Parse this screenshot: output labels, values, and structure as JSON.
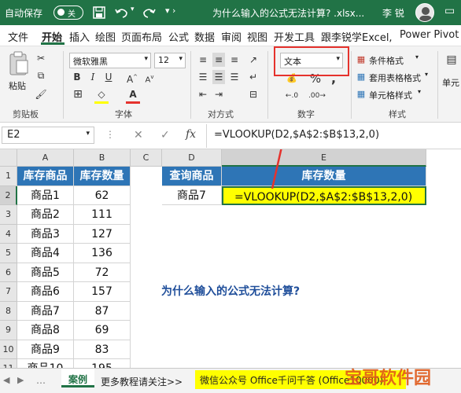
{
  "titlebar": {
    "autosave_label": "自动保存",
    "autosave_state": "关",
    "file_title": "为什么输入的公式无法计算? .xlsx...",
    "user_name": "李 锐"
  },
  "tabs": [
    "文件",
    "开始",
    "插入",
    "绘图",
    "页面布局",
    "公式",
    "数据",
    "审阅",
    "视图",
    "开发工具",
    "跟李锐学Excel,",
    "Power Pivot"
  ],
  "ribbon": {
    "paste_label": "粘贴",
    "clipboard_group": "剪贴板",
    "font_name": "微软雅黑",
    "font_size": "12",
    "font_group": "字体",
    "align_group": "对方式",
    "number_format": "文本",
    "number_group": "数字",
    "styles": [
      "条件格式",
      "套用表格格式",
      "单元格样式"
    ],
    "styles_group": "样式",
    "cells_label": "单元"
  },
  "formula_bar": {
    "name_box": "E2",
    "fx": "fx",
    "formula": "=VLOOKUP(D2,$A$2:$B$13,2,0)"
  },
  "grid": {
    "columns": [
      "A",
      "B",
      "C",
      "D",
      "E"
    ],
    "rows": [
      "1",
      "2",
      "3",
      "4",
      "5",
      "6",
      "7",
      "8",
      "9",
      "10",
      "11"
    ],
    "header_a": "库存商品",
    "header_b": "库存数量",
    "items": [
      {
        "name": "商品1",
        "qty": "62"
      },
      {
        "name": "商品2",
        "qty": "111"
      },
      {
        "name": "商品3",
        "qty": "127"
      },
      {
        "name": "商品4",
        "qty": "136"
      },
      {
        "name": "商品5",
        "qty": "72"
      },
      {
        "name": "商品6",
        "qty": "157"
      },
      {
        "name": "商品7",
        "qty": "87"
      },
      {
        "name": "商品8",
        "qty": "69"
      },
      {
        "name": "商品9",
        "qty": "83"
      },
      {
        "name": "商品10",
        "qty": "195"
      }
    ],
    "query_header_d": "查询商品",
    "query_header_e": "库存数量",
    "query_value": "商品7",
    "formula_text": "=VLOOKUP(D2,$A$2:$B$13,2,0)",
    "question": "为什么输入的公式无法计算?"
  },
  "sheet_tabs": {
    "active": "案例",
    "more": "更多教程请关注>>",
    "promo": "微信公众号 Office千问千答 (Office10000)",
    "watermark": "宝哥软件园"
  },
  "colors": {
    "excel_green": "#217346",
    "header_blue": "#2e75b6",
    "formula_yellow": "#ffff00",
    "annotation_red": "#e5322d"
  }
}
